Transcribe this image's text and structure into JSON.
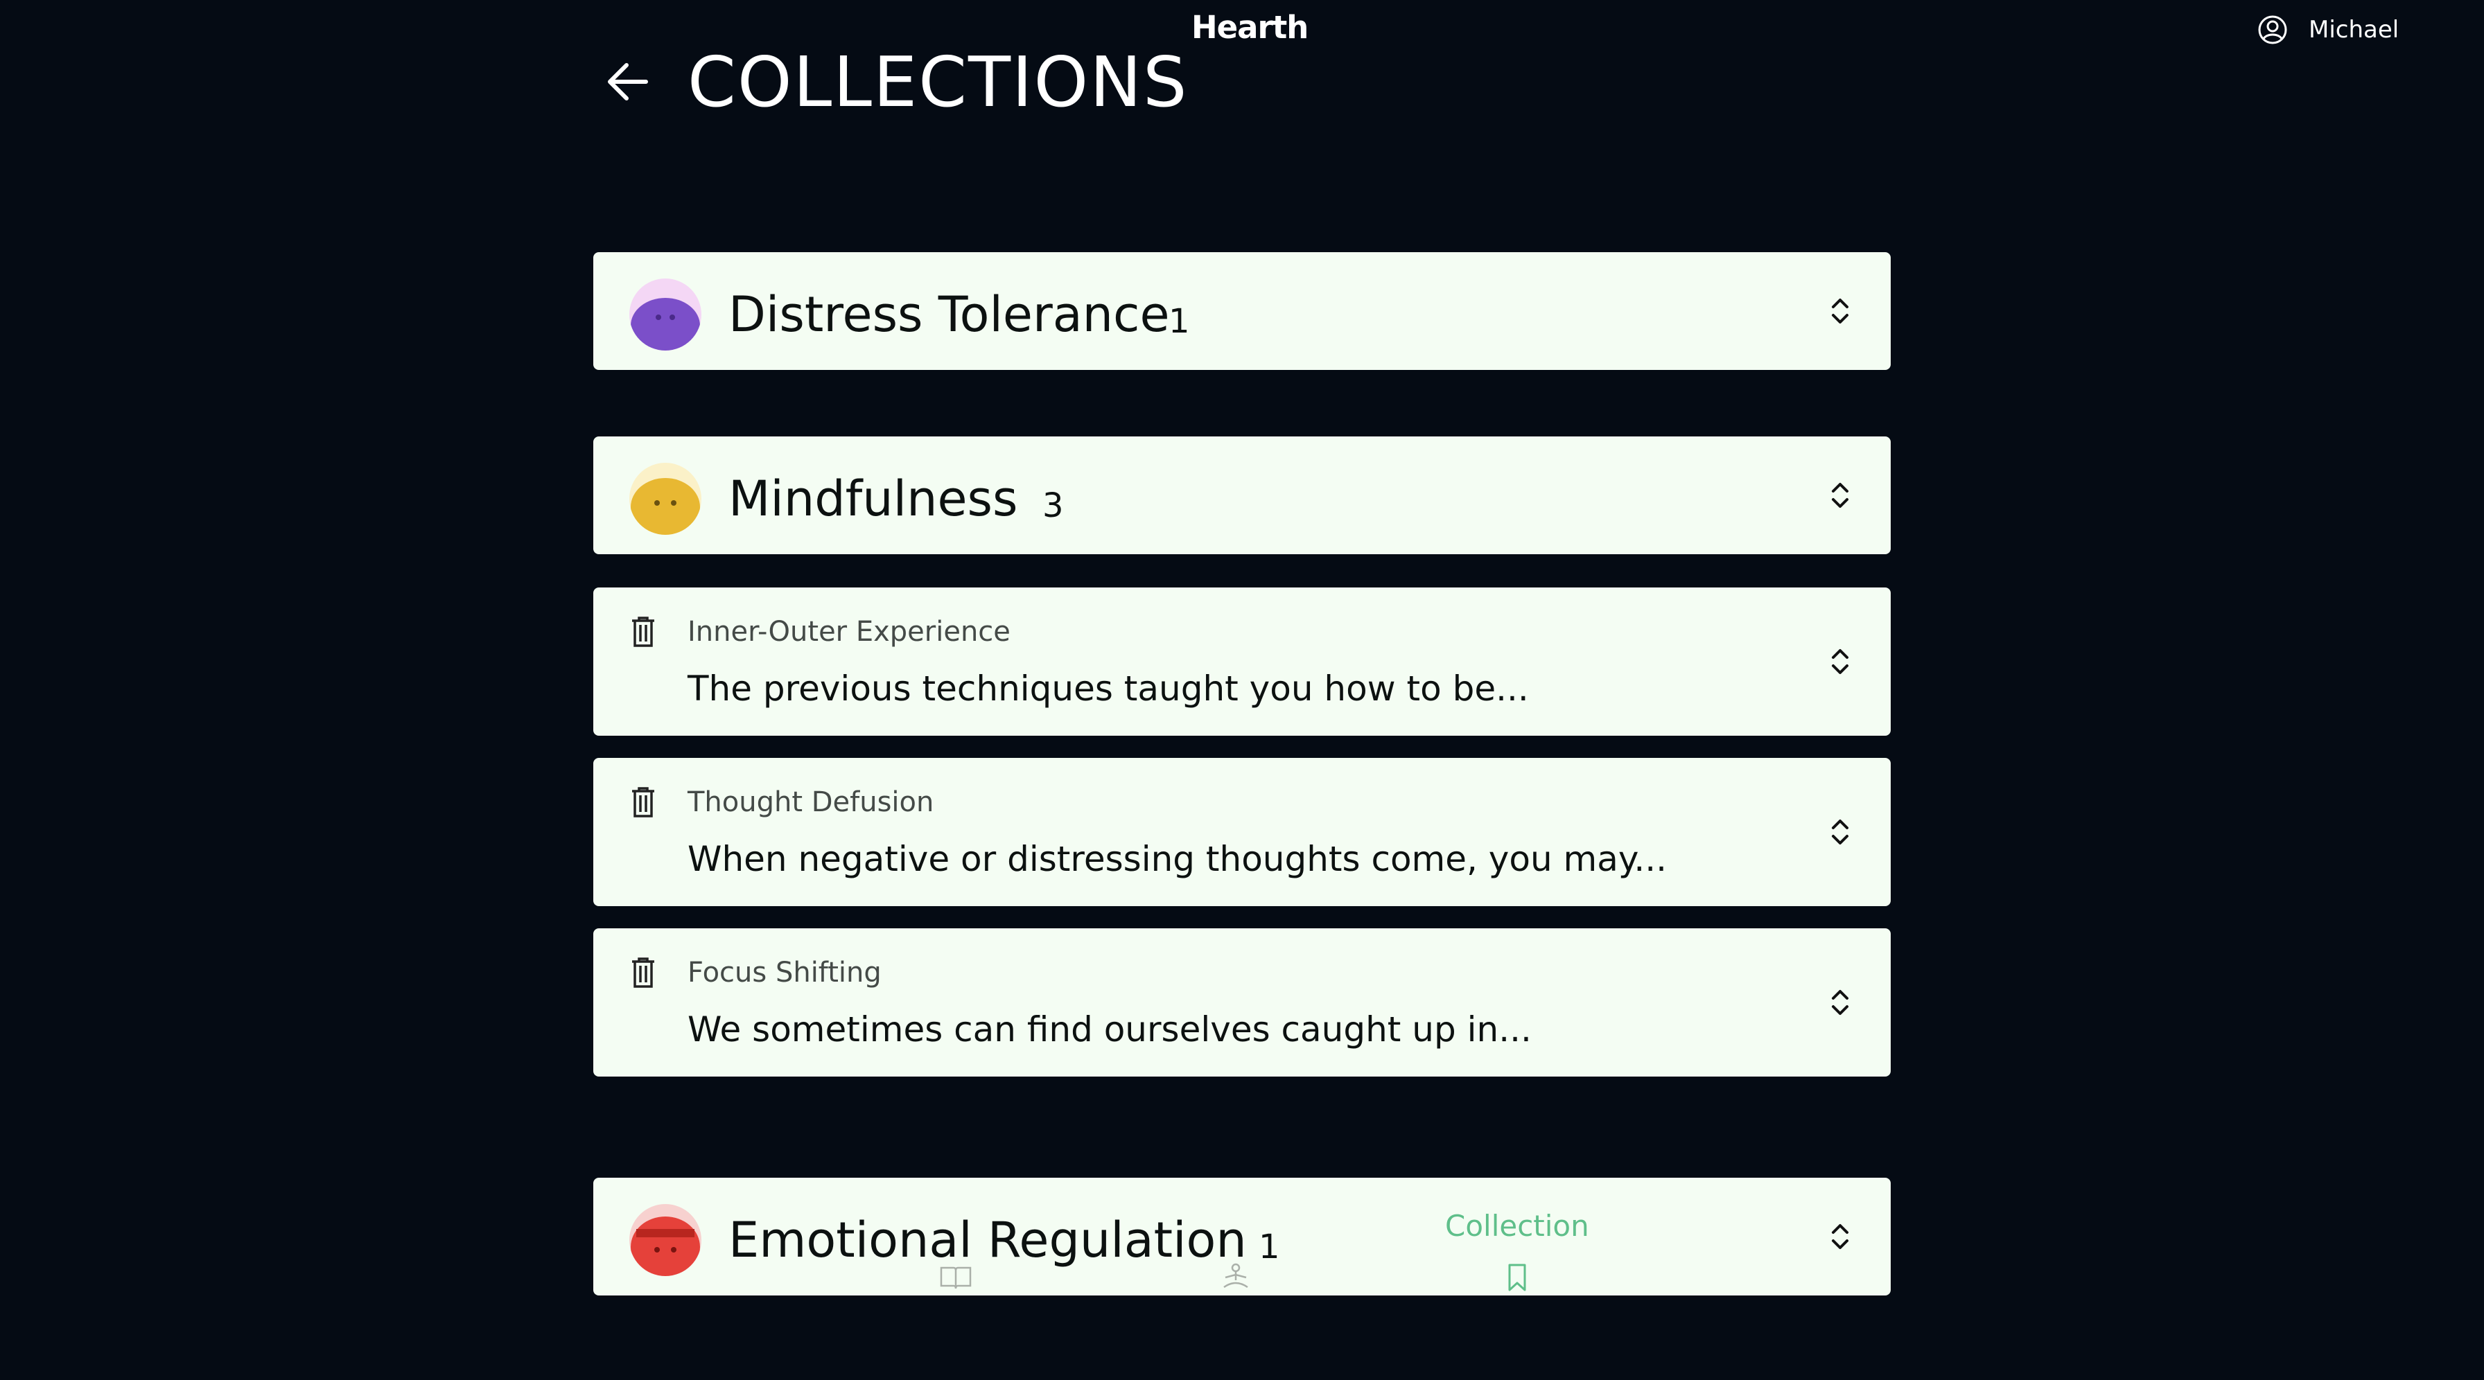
{
  "app": {
    "brand": "Hearth"
  },
  "user": {
    "name": "Michael",
    "icon": "user-circle-icon"
  },
  "header": {
    "title": "COLLECTIONS",
    "back_icon": "arrow-left-icon"
  },
  "collections": [
    {
      "name": "Distress Tolerance",
      "count": "1",
      "color": "#7b4fc9"
    },
    {
      "name": "Mindfulness",
      "count": "3",
      "color": "#e8b832",
      "items": [
        {
          "title": "Inner-Outer Experience",
          "text": "The previous techniques taught you how to be..."
        },
        {
          "title": "Thought Defusion",
          "text": "When negative or distressing thoughts come, you may..."
        },
        {
          "title": "Focus Shifting",
          "text": "We sometimes can find ourselves caught up in..."
        }
      ]
    },
    {
      "name": "Emotional Regulation",
      "count": "1",
      "color": "#e5413a"
    }
  ],
  "bottom_nav": {
    "items": [
      {
        "label": "",
        "icon": "book-icon"
      },
      {
        "label": "",
        "icon": "meditation-icon"
      },
      {
        "label": "Collection",
        "icon": "bookmark-icon",
        "active": true
      }
    ],
    "active_color": "#5fbf8a"
  }
}
